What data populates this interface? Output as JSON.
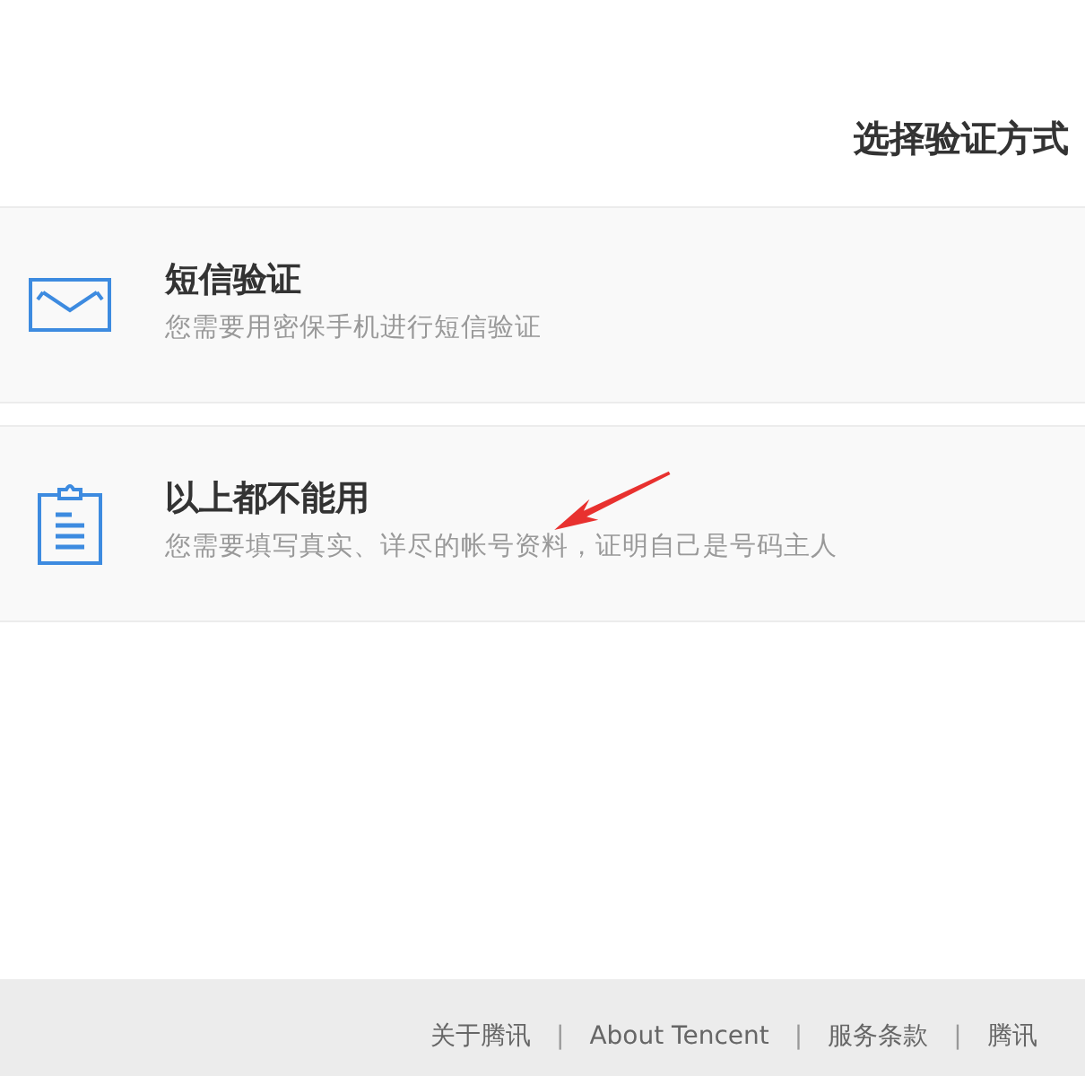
{
  "title": "选择验证方式",
  "options": [
    {
      "kind": "sms",
      "title": "短信验证",
      "description": "您需要用密保手机进行短信验证"
    },
    {
      "kind": "form",
      "title": "以上都不能用",
      "description": "您需要填写真实、详尽的帐号资料，证明自己是号码主人"
    }
  ],
  "footer_items": [
    {
      "kind": "link",
      "text": "关于腾讯"
    },
    {
      "kind": "separator",
      "text": "|"
    },
    {
      "kind": "link",
      "text": "About Tencent"
    },
    {
      "kind": "separator",
      "text": "|"
    },
    {
      "kind": "link",
      "text": "服务条款"
    },
    {
      "kind": "separator",
      "text": "|"
    },
    {
      "kind": "link",
      "text": "腾讯"
    }
  ]
}
